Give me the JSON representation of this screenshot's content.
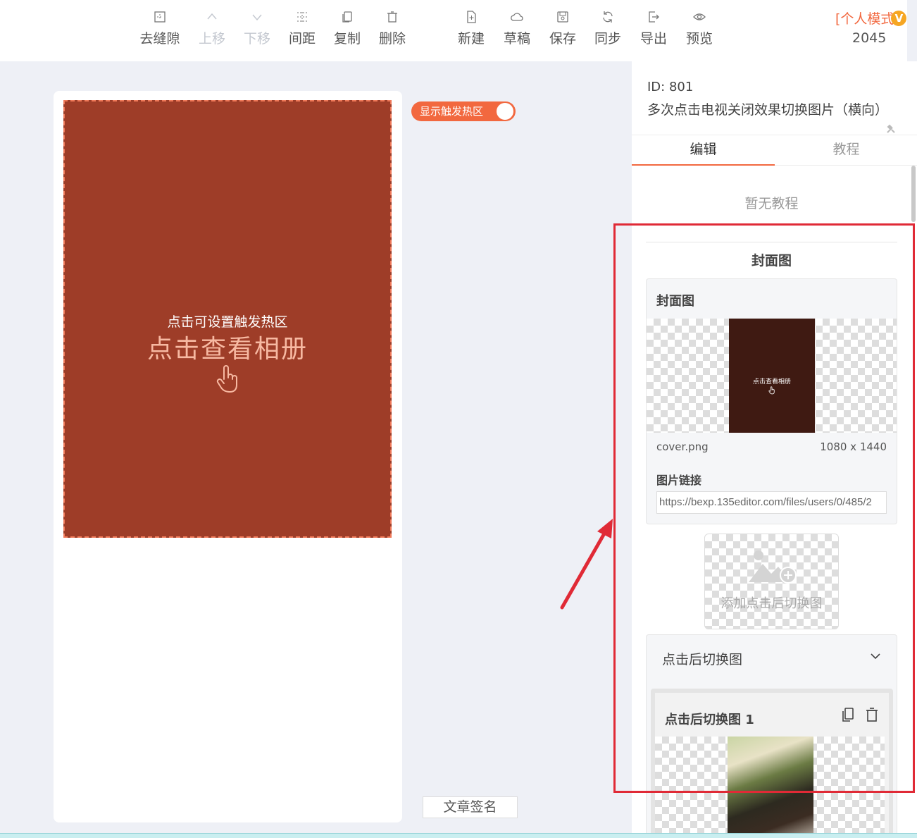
{
  "toolbar": {
    "left_buttons": [
      {
        "label": "去缝隙",
        "icon": "remove-gap-icon",
        "disabled": false
      },
      {
        "label": "上移",
        "icon": "move-up-icon",
        "disabled": true
      },
      {
        "label": "下移",
        "icon": "move-down-icon",
        "disabled": true
      },
      {
        "label": "间距",
        "icon": "spacing-icon",
        "disabled": false
      },
      {
        "label": "复制",
        "icon": "copy-icon",
        "disabled": false
      },
      {
        "label": "删除",
        "icon": "trash-icon",
        "disabled": false
      }
    ],
    "right_buttons": [
      {
        "label": "新建",
        "icon": "new-file-icon"
      },
      {
        "label": "草稿",
        "icon": "cloud-icon"
      },
      {
        "label": "保存",
        "icon": "save-icon"
      },
      {
        "label": "同步",
        "icon": "sync-icon"
      },
      {
        "label": "导出",
        "icon": "export-icon"
      },
      {
        "label": "预览",
        "icon": "eye-icon"
      }
    ],
    "mode_label": "[个人模式",
    "vip_badge": "V",
    "count": "2045"
  },
  "canvas": {
    "hotspot_hint": "点击可设置触发热区",
    "cover_text": "点击查看相册",
    "toggle_label": "显示触发热区",
    "toggle_on": true,
    "signature_button": "文章签名",
    "cover_color": "#9e3d28"
  },
  "panel": {
    "id_line": "ID: 801",
    "title": "多次点击电视关闭效果切换图片（横向）",
    "tabs": [
      {
        "label": "编辑",
        "active": true
      },
      {
        "label": "教程",
        "active": false
      }
    ],
    "no_tutorial": "暂无教程",
    "section_title": "封面图",
    "cover_card": {
      "title": "封面图",
      "thumb_text": "点击查看相册",
      "file_name": "cover.png",
      "file_size": "1080 x 1440",
      "link_label": "图片链接",
      "link_value": "https://bexp.135editor.com/files/users/0/485/2"
    },
    "add_switch_label": "添加点击后切换图",
    "accordion": {
      "title": "点击后切换图",
      "item_title": "点击后切换图 1"
    }
  },
  "colors": {
    "accent": "#f2683f",
    "highlight_box": "#e02a36"
  }
}
